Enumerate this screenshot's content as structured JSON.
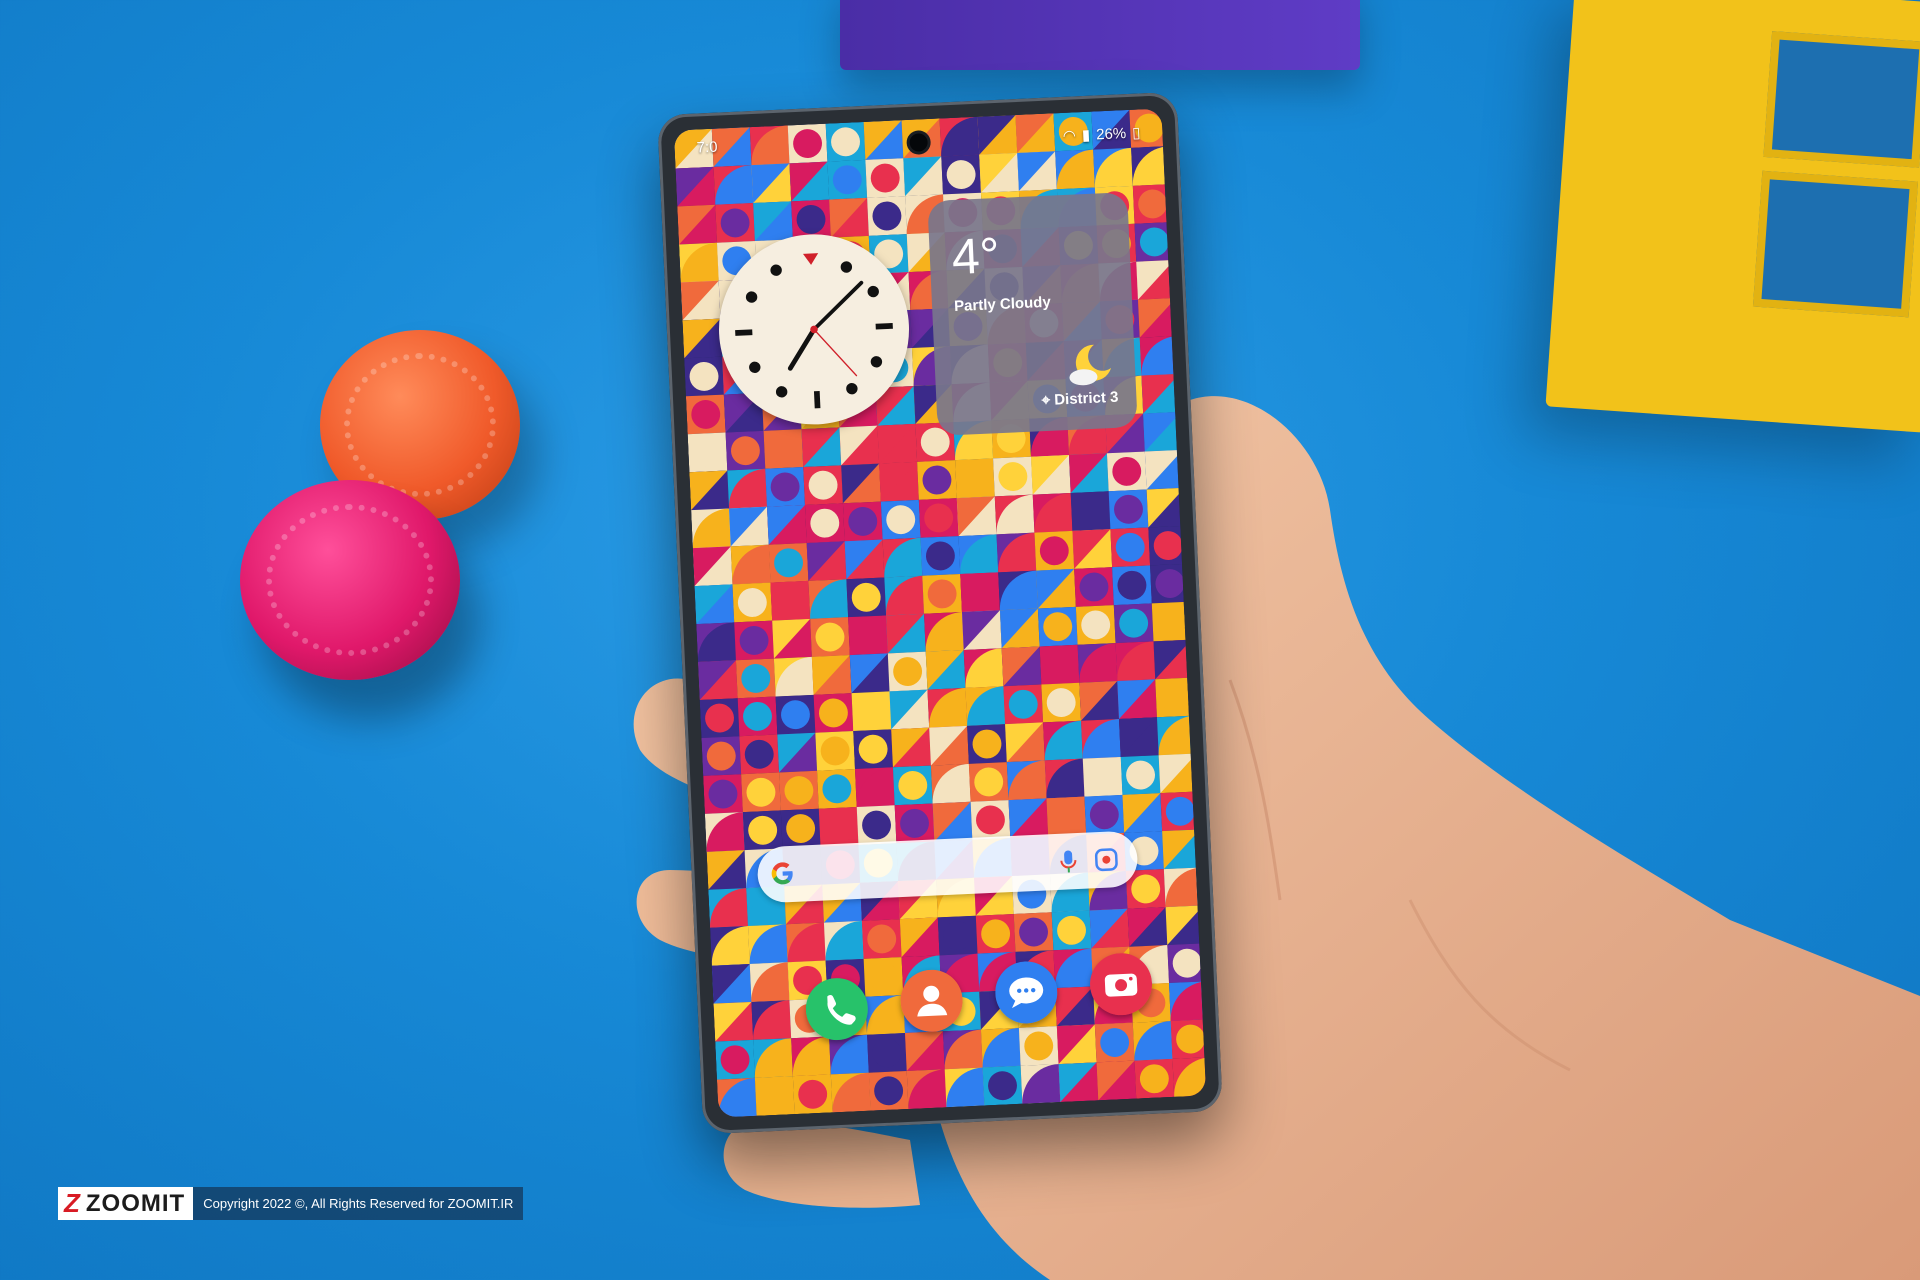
{
  "status_bar": {
    "time": "7:0",
    "battery": "26%"
  },
  "weather_widget": {
    "temperature": "4°",
    "condition": "Partly Cloudy",
    "location": "District 3"
  },
  "dock": {
    "icons": [
      "phone-icon",
      "contacts-icon",
      "messages-icon",
      "camera-icon"
    ]
  },
  "watermark": {
    "brand": "ZOOMIT",
    "copyright": "Copyright 2022 ©, All Rights Reserved for ZOOMIT.IR"
  },
  "colors": {
    "table": "#1789d6",
    "phone_app": "#27c26a",
    "contacts_app": "#f06a3c",
    "messages_app": "#2f7ff0",
    "camera_app": "#e8304e"
  }
}
